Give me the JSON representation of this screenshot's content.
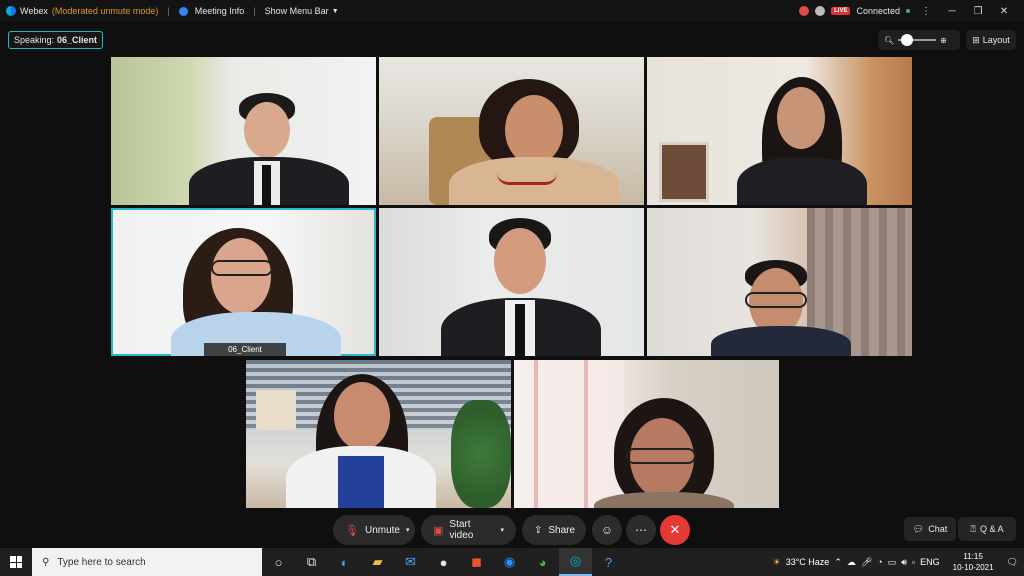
{
  "titlebar": {
    "app_name": "Webex",
    "mode": "(Moderated unmute mode)",
    "meeting_info": "Meeting Info",
    "show_menu_bar": "Show Menu Bar",
    "live_label": "LIVE",
    "connection_status": "Connected"
  },
  "speaking": {
    "label": "Speaking:",
    "name": "06_Client"
  },
  "view": {
    "layout_label": "Layout",
    "zoom_level": 0.1
  },
  "participants": [
    {
      "id": 1
    },
    {
      "id": 2
    },
    {
      "id": 3
    },
    {
      "id": 4,
      "name": "06_Client",
      "speaking": true
    },
    {
      "id": 5
    },
    {
      "id": 6
    },
    {
      "id": 7
    },
    {
      "id": 8
    }
  ],
  "controls": {
    "unmute": "Unmute",
    "start_video": "Start video",
    "share": "Share",
    "chat": "Chat",
    "qa": "Q & A"
  },
  "taskbar": {
    "search_placeholder": "Type here to search",
    "weather": "33°C  Haze",
    "language": "ENG",
    "time": "11:15",
    "date": "10-10-2021"
  },
  "colors": {
    "accent": "#2ab7ca",
    "end_call": "#e53935",
    "mode_text": "#d89a2c"
  },
  "icons": [
    "webex-logo-icon",
    "info-icon",
    "chevron-down-icon",
    "record-icon",
    "zoom-out-icon",
    "zoom-in-icon",
    "layout-icon",
    "mic-muted-icon",
    "video-off-icon",
    "share-icon",
    "reactions-icon",
    "more-icon",
    "close-icon",
    "chat-icon",
    "qa-icon",
    "windows-icon",
    "search-icon"
  ]
}
